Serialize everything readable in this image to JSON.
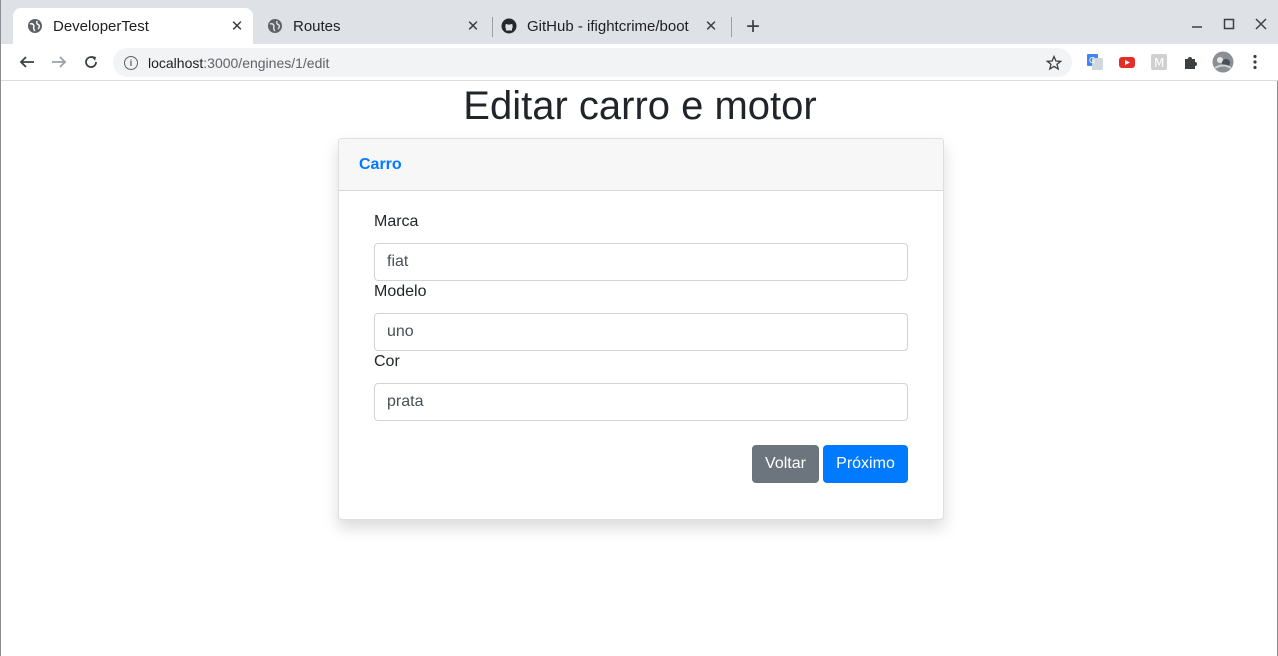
{
  "browser": {
    "tabs": [
      {
        "title": "DeveloperTest",
        "icon": "globe-icon",
        "active": true
      },
      {
        "title": "Routes",
        "icon": "globe-icon",
        "active": false
      },
      {
        "title": "GitHub - ifightcrime/boot",
        "icon": "github-icon",
        "active": false
      }
    ],
    "new_tab_label": "+",
    "address": {
      "host": "localhost",
      "path": ":3000/engines/1/edit"
    }
  },
  "page": {
    "title": "Editar carro e motor",
    "card": {
      "header_link": "Carro",
      "fields": [
        {
          "label": "Marca",
          "value": "fiat"
        },
        {
          "label": "Modelo",
          "value": "uno"
        },
        {
          "label": "Cor",
          "value": "prata"
        }
      ],
      "back_button": "Voltar",
      "next_button": "Próximo"
    }
  },
  "colors": {
    "primary": "#007bff",
    "secondary": "#6c757d",
    "tabstrip": "#dee1e6"
  }
}
